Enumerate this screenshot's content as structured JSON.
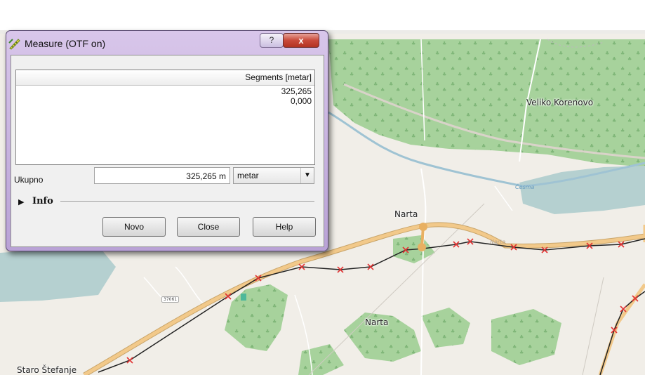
{
  "window": {
    "title": "Measure (OTF on)",
    "help_glyph": "?",
    "close_glyph": "x"
  },
  "segments": {
    "header": "Segments [metar]",
    "rows": [
      "325,265",
      "0,000"
    ]
  },
  "total": {
    "label": "Ukupno",
    "value": "325,265 m"
  },
  "unit": {
    "selected": "metar",
    "arrow_glyph": "▼"
  },
  "info": {
    "label": "Info",
    "glyph": "▶"
  },
  "buttons": {
    "new": "Novo",
    "close": "Close",
    "help": "Help"
  },
  "map": {
    "labels": {
      "veliko_korenovo": "Veliko Korenovo",
      "narta_north": "Narta",
      "narta_south": "Narta",
      "staro_stefanje": "Staro Štefanje",
      "road_number": "37061",
      "water": "Česma",
      "road_name": "Narta"
    },
    "colors": {
      "land": "#f1eee8",
      "forest": "#a7d29c",
      "water": "#b5d0d0",
      "highway": "#f2c98a",
      "measure_line": "#222222",
      "vertex": "#e23434"
    }
  }
}
